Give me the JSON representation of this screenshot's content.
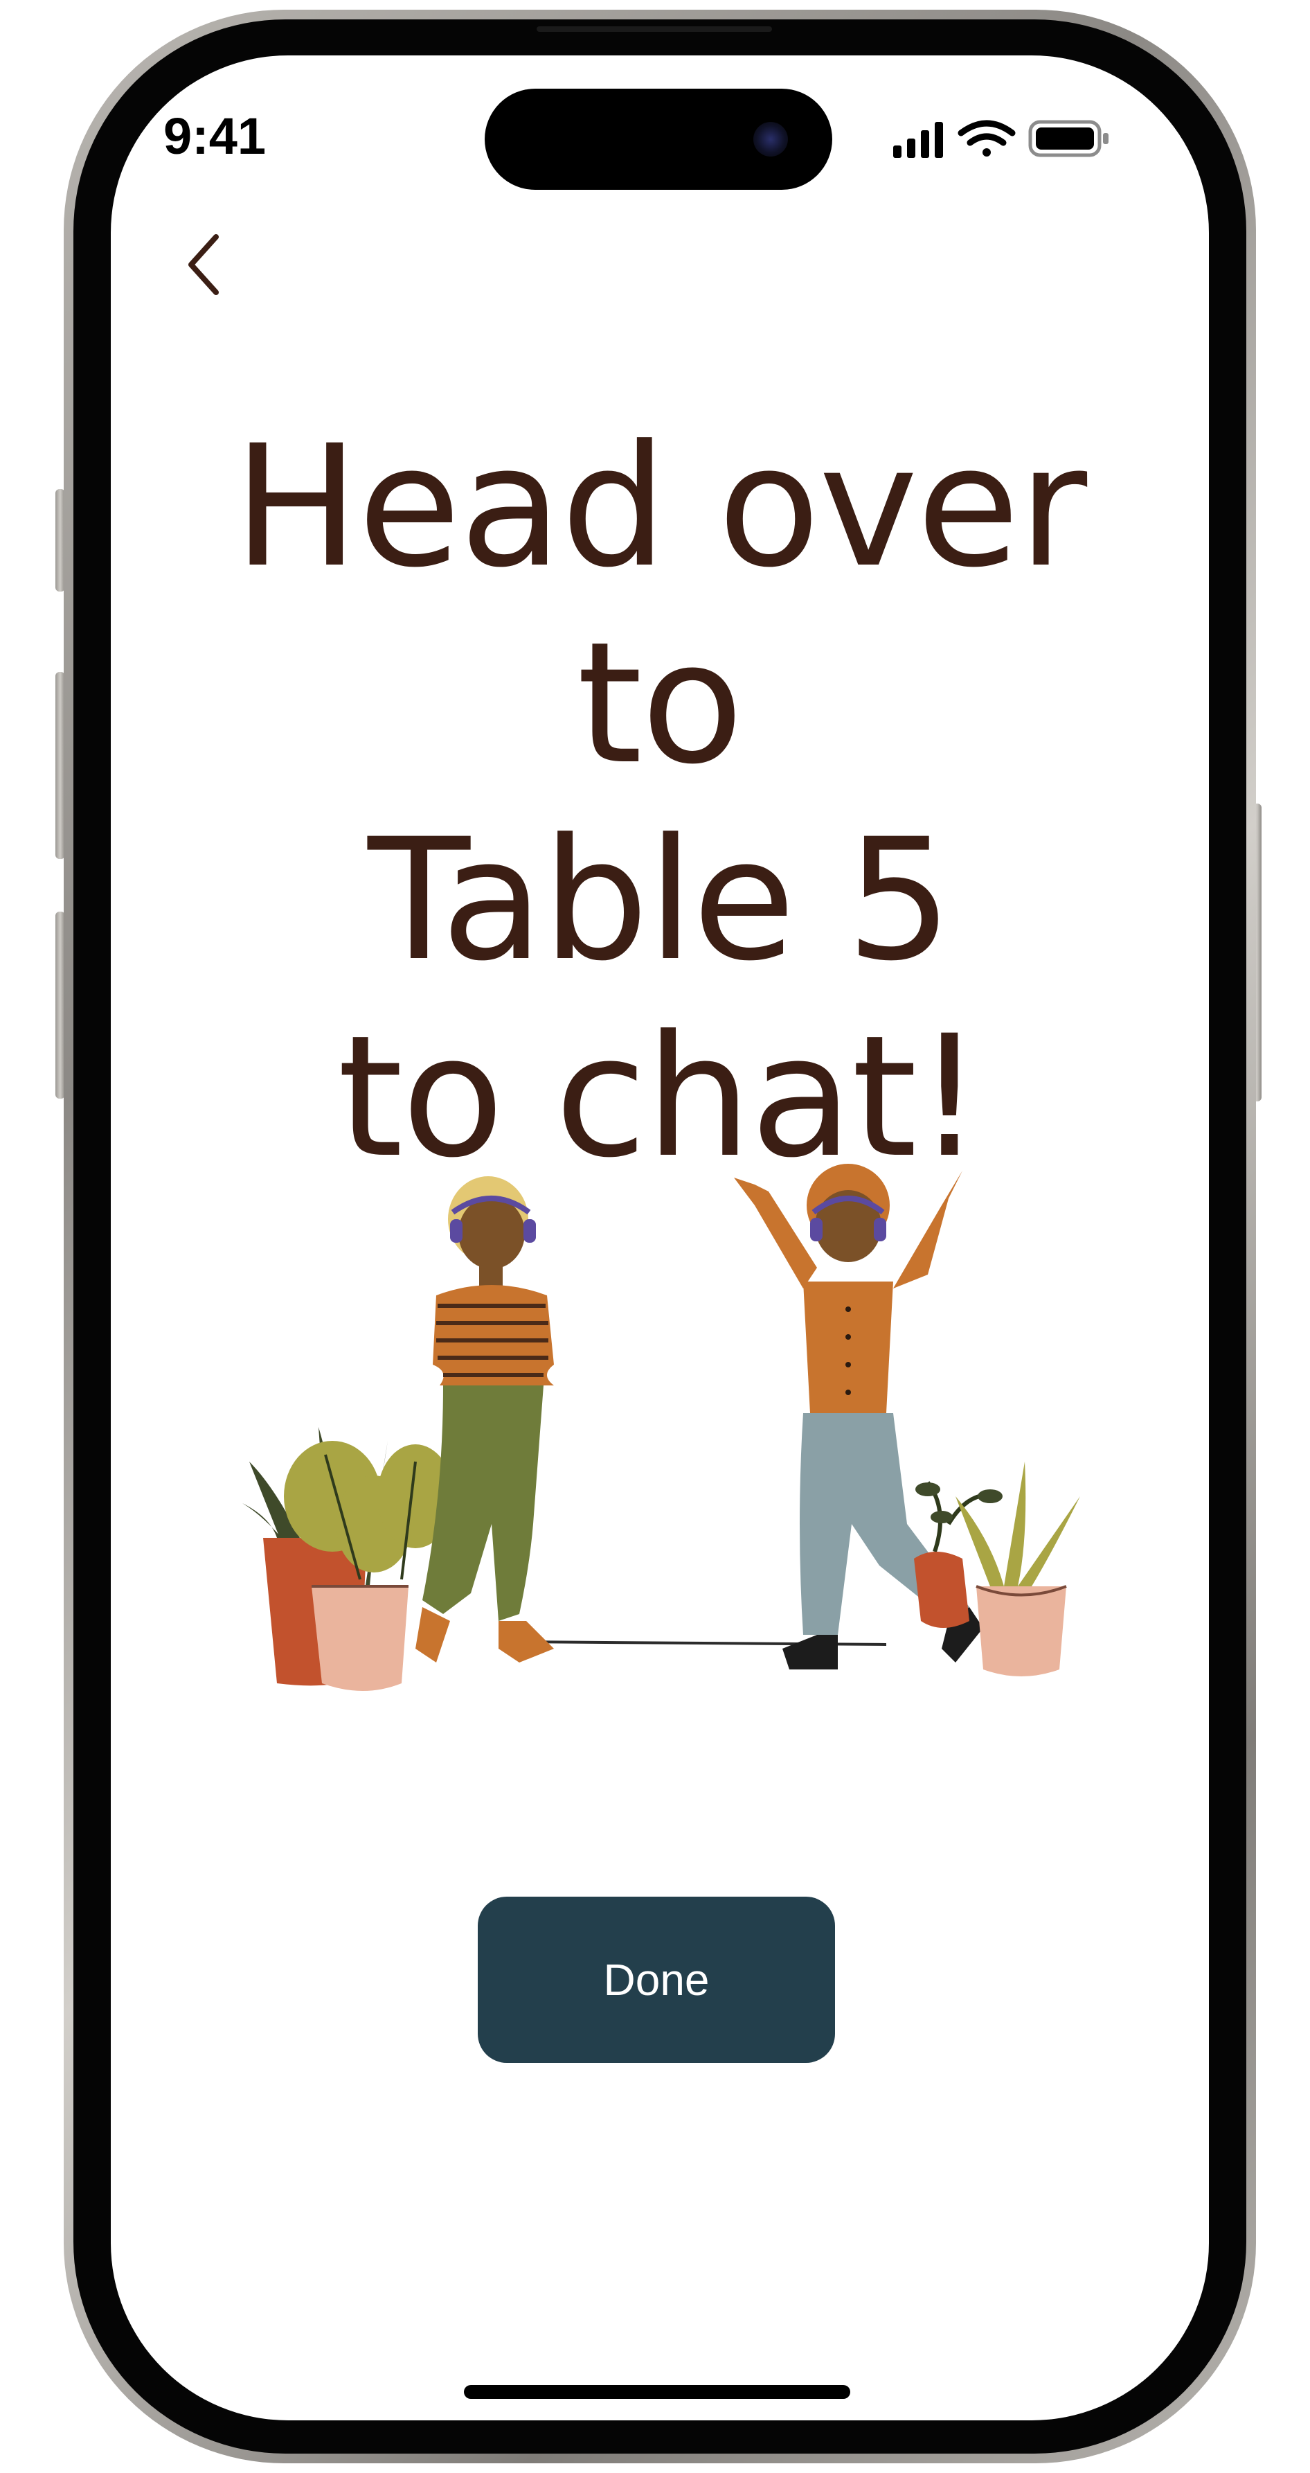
{
  "status_bar": {
    "time": "9:41",
    "icons": [
      "cellular-signal-icon",
      "wifi-icon",
      "battery-icon"
    ]
  },
  "navigation": {
    "back_icon": "chevron-left-icon"
  },
  "headline": {
    "lines": [
      "Head over to",
      "Table 5",
      "to chat!"
    ]
  },
  "illustration": {
    "description_icon": "two-people-with-plants-illustration"
  },
  "actions": {
    "done_label": "Done"
  },
  "colors": {
    "headline": "#3b1e14",
    "button_bg": "#233f4c",
    "button_text": "#ffffff",
    "background": "#ffffff"
  }
}
